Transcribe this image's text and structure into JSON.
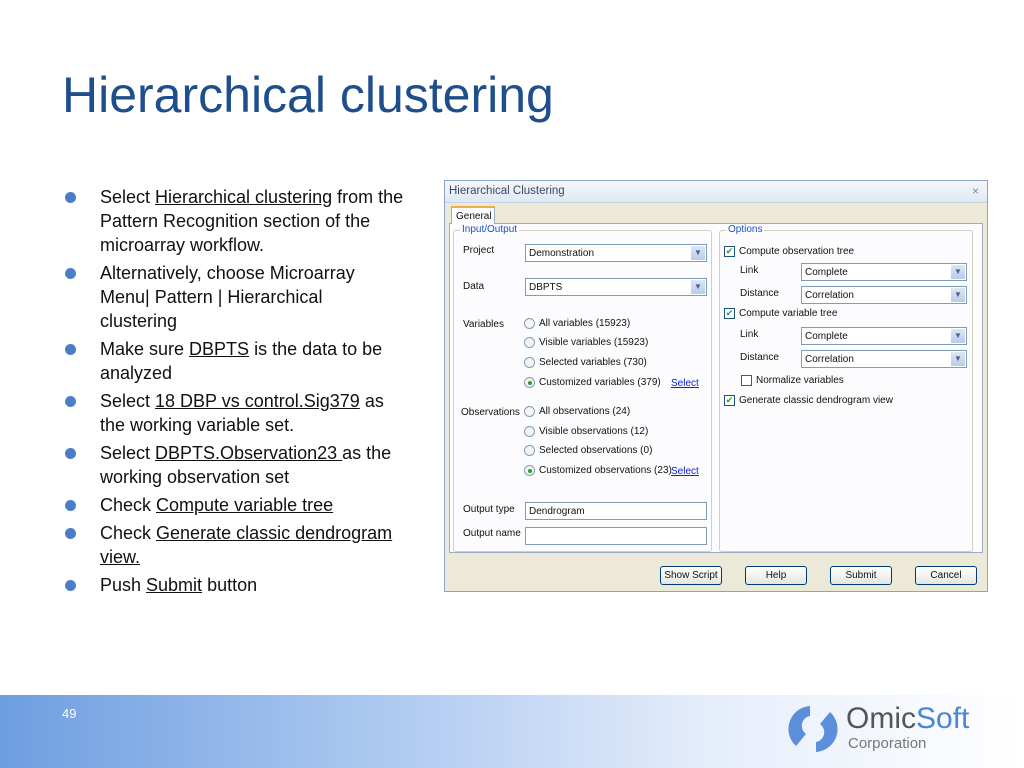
{
  "slide": {
    "title": "Hierarchical clustering",
    "page_number": "49"
  },
  "bullets": [
    {
      "pre": "Select ",
      "link": "Hierarchical clustering",
      "post": " from the Pattern Recognition section of the microarray workflow."
    },
    {
      "pre": "Alternatively, choose Microarray Menu| Pattern | Hierarchical clustering",
      "link": "",
      "post": ""
    },
    {
      "pre": "Make sure ",
      "link": "DBPTS",
      "post": " is the data to be analyzed"
    },
    {
      "pre": "Select ",
      "link": "18 DBP vs control.Sig379",
      "post": " as the working variable set."
    },
    {
      "pre": "Select ",
      "link": "DBPTS.Observation23 ",
      "post": "as the working observation set"
    },
    {
      "pre": "Check ",
      "link": "Compute variable tree",
      "post": ""
    },
    {
      "pre": "Check ",
      "link": "Generate classic dendrogram view.",
      "post": ""
    },
    {
      "pre": "Push ",
      "link": "Submit",
      "post": " button"
    }
  ],
  "logo": {
    "name1": "Omic",
    "name2": "Soft",
    "sub": "Corporation"
  },
  "dialog": {
    "title": "Hierarchical Clustering",
    "close": "×",
    "tab": "General",
    "io": {
      "legend": "Input/Output",
      "project_label": "Project",
      "project": "Demonstration",
      "data_label": "Data",
      "data": "DBPTS",
      "variables_label": "Variables",
      "variables": [
        "All variables (15923)",
        "Visible variables (15923)",
        "Selected variables (730)",
        "Customized variables (379)"
      ],
      "observations_label": "Observations",
      "observations": [
        "All observations (24)",
        "Visible observations (12)",
        "Selected observations (0)",
        "Customized observations (23)"
      ],
      "select": "Select",
      "output_type_label": "Output type",
      "output_type": "Dendrogram",
      "output_name_label": "Output name",
      "output_name": ""
    },
    "options": {
      "legend": "Options",
      "obs_tree": "Compute observation tree",
      "var_tree": "Compute variable tree",
      "link_label": "Link",
      "distance_label": "Distance",
      "obs_link": "Complete",
      "obs_distance": "Correlation",
      "var_link": "Complete",
      "var_distance": "Correlation",
      "normalize": "Normalize variables",
      "dendro": "Generate classic dendrogram view"
    },
    "buttons": {
      "show_script": "Show Script",
      "help": "Help",
      "submit": "Submit",
      "cancel": "Cancel"
    }
  }
}
